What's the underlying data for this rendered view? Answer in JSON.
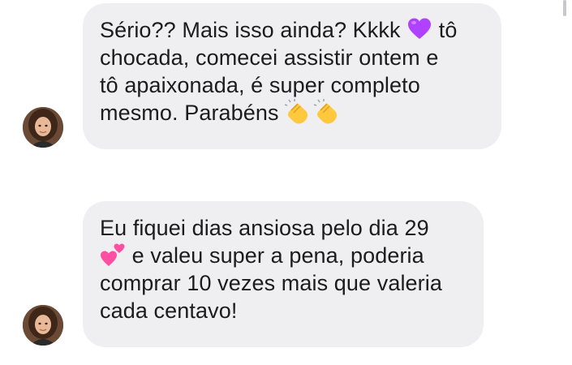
{
  "messages": [
    {
      "lines": [
        {
          "before": "Sério?? Mais isso ainda? Kkkk ",
          "emoji": "purple-heart-icon",
          "after": " tô"
        },
        {
          "text": "chocada, comecei assistir ontem e"
        },
        {
          "text": "tô apaixonada, é super completo"
        },
        {
          "before": "mesmo. Parabéns ",
          "emoji": "clapping-hands-icon",
          "after": ""
        }
      ]
    },
    {
      "lines": [
        {
          "text": "Eu fiquei dias ansiosa pelo dia 29"
        },
        {
          "before": "",
          "emoji": "two-hearts-icon",
          "after": " e valeu super a pena, poderia"
        },
        {
          "text": "comprar 10 vezes mais que valeria"
        },
        {
          "text": "cada centavo!"
        }
      ]
    }
  ],
  "colors": {
    "bubble": "#efeff1",
    "text": "#1c1c1e",
    "purple_heart": "#b042ff",
    "pink_hearts": "#ff4fa3",
    "clap": "#ffc83d"
  }
}
